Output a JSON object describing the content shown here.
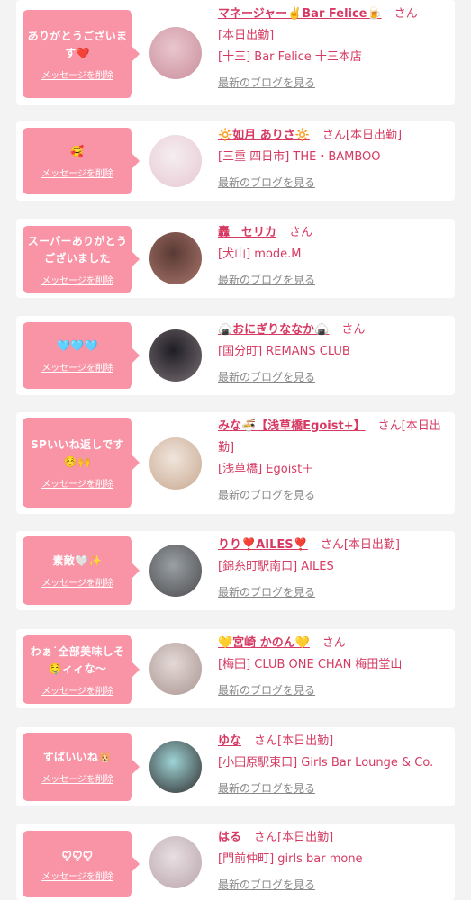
{
  "cards": [
    {
      "message": "ありがとうございます❤️",
      "delete_label": "メッセージを削除",
      "name": "マネージャー✌️Bar Felice🍺",
      "san": "さん",
      "work": "[本日出勤]",
      "location": "[十三] Bar Felice 十三本店",
      "blog_label": "最新のブログを見る",
      "avatar_colors": [
        "#e9c6cf",
        "#c98e9a"
      ]
    },
    {
      "message": "🥰",
      "delete_label": "メッセージを削除",
      "name": "🔆如月 ありさ🔆",
      "san": "さん",
      "work": "[本日出勤]",
      "location": "[三重 四日市] THE・BAMBOO",
      "blog_label": "最新のブログを見る",
      "avatar_colors": [
        "#f5eef0",
        "#e7c8d2"
      ]
    },
    {
      "message": "スーパーありがとうございました",
      "delete_label": "メッセージを削除",
      "name": "轟　セリカ",
      "san": "さん",
      "work": "",
      "location": "[犬山] mode.M",
      "blog_label": "最新のブログを見る",
      "avatar_colors": [
        "#5a3a35",
        "#a8756a"
      ]
    },
    {
      "message": "🩵🩵🩵",
      "delete_label": "メッセージを削除",
      "name": "🍙おにぎりななか🍙",
      "san": "さん",
      "work": "",
      "location": "[国分町] REMANS CLUB",
      "blog_label": "最新のブログを見る",
      "avatar_colors": [
        "#1e1e24",
        "#7a6f74"
      ]
    },
    {
      "message": "SPいいね返しです☺️🙌",
      "delete_label": "メッセージを削除",
      "name": "みな🍜【浅草橋Egoist+】",
      "san": "さん",
      "work": "[本日出勤]",
      "location": "[浅草橋] Egoist＋",
      "blog_label": "最新のブログを見る",
      "avatar_colors": [
        "#f0e5dc",
        "#c8a890"
      ]
    },
    {
      "message": "素敵🤍✨",
      "delete_label": "メッセージを削除",
      "name": "りり❣️AILES❣️",
      "san": "さん",
      "work": "[本日出勤]",
      "location": "[錦糸町駅南口] AILES",
      "blog_label": "最新のブログを見る",
      "avatar_colors": [
        "#9aa0a4",
        "#4b4a4c"
      ]
    },
    {
      "message": "わぁ˙全部美味しそ🤤ィィな〜",
      "delete_label": "メッセージを削除",
      "name": "💛宮崎 かのん💛",
      "san": "さん",
      "work": "",
      "location": "[梅田] CLUB ONE CHAN 梅田堂山",
      "blog_label": "最新のブログを見る",
      "avatar_colors": [
        "#e4d9d6",
        "#a99591"
      ]
    },
    {
      "message": "すばいいね🐹",
      "delete_label": "メッセージを削除",
      "name": "ゆな",
      "san": "さん",
      "work": "[本日出勤]",
      "location": "[小田原駅東口] Girls Bar Lounge & Co.",
      "blog_label": "最新のブログを見る",
      "avatar_colors": [
        "#9fd4d6",
        "#2d2a2b"
      ]
    },
    {
      "message": "ꨄ︎ꨄ︎ꨄ︎",
      "delete_label": "メッセージを削除",
      "name": "はる",
      "san": "さん",
      "work": "[本日出勤]",
      "location": "[門前仲町] girls bar mone",
      "blog_label": "最新のブログを見る",
      "avatar_colors": [
        "#e8dfe2",
        "#b9a4ab"
      ]
    }
  ]
}
